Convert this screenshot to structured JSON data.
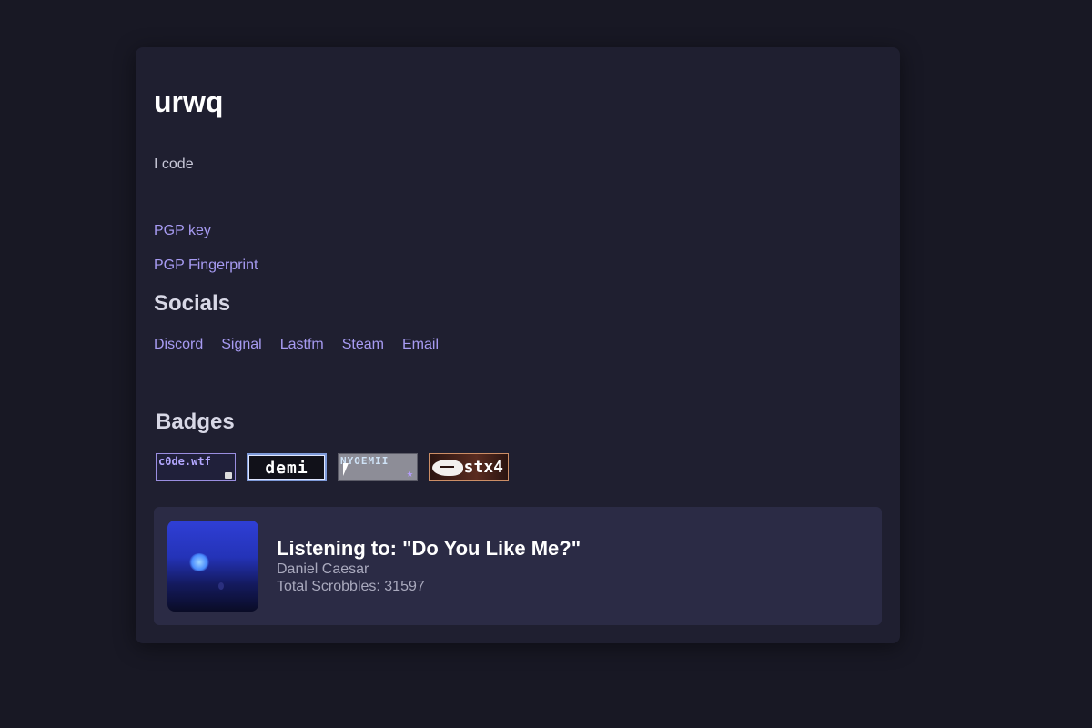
{
  "profile": {
    "username": "urwq",
    "bio": "I code"
  },
  "links": {
    "pgp_key": "PGP key",
    "pgp_fingerprint": "PGP Fingerprint"
  },
  "socials": {
    "title": "Socials",
    "items": [
      "Discord",
      "Signal",
      "Lastfm",
      "Steam",
      "Email"
    ]
  },
  "badges": {
    "title": "Badges",
    "items": [
      {
        "label": "c0de.wtf"
      },
      {
        "label": "demi"
      },
      {
        "label": "NYOEMII"
      },
      {
        "label": "stx4"
      }
    ]
  },
  "now_playing": {
    "title": "Listening to: \"Do You Like Me?\"",
    "artist": "Daniel Caesar",
    "scrobbles": "Total Scrobbles: 31597"
  },
  "colors": {
    "background": "#181824",
    "card": "#1f1f30",
    "link": "#a79bf2",
    "now_playing_card": "#2b2b45"
  }
}
